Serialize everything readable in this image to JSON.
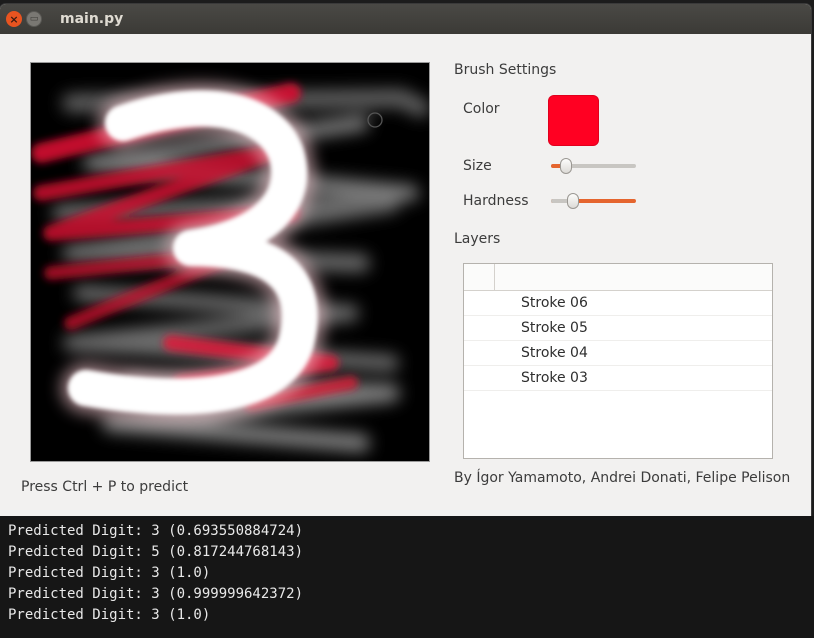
{
  "window": {
    "title": "main.py",
    "close_icon": "close-icon",
    "minimize_icon": "minimize-icon"
  },
  "canvas": {
    "hint": "Press Ctrl + P to predict",
    "drawn_digit": "3",
    "brush_cursor_icon": "circle-cursor-icon"
  },
  "brush_settings": {
    "heading": "Brush Settings",
    "color_label": "Color",
    "color_value": "#ff0022",
    "size_label": "Size",
    "size_value": 0.12,
    "hardness_label": "Hardness",
    "hardness_value": 0.22
  },
  "layers": {
    "heading": "Layers",
    "items": [
      {
        "label": "Stroke 06"
      },
      {
        "label": "Stroke 05"
      },
      {
        "label": "Stroke 04"
      },
      {
        "label": "Stroke 03"
      }
    ]
  },
  "credits": "By Ígor Yamamoto, Andrei Donati, Felipe Pelison",
  "terminal": {
    "lines": [
      "Predicted Digit: 3 (0.693550884724)",
      "Predicted Digit: 5 (0.817244768143)",
      "Predicted Digit: 3 (1.0)",
      "Predicted Digit: 3 (0.999999642372)",
      "Predicted Digit: 3 (1.0)"
    ]
  }
}
